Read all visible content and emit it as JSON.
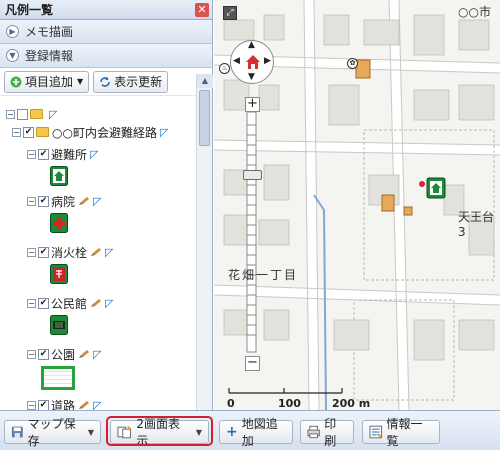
{
  "panel": {
    "title": "凡例一覧",
    "section_memo": "メモ描画",
    "section_registered": "登録情報",
    "add_item_label": "項目追加",
    "refresh_label": "表示更新"
  },
  "tree": {
    "group_label": "○○町内会避難経路",
    "items": [
      {
        "label": "避難所"
      },
      {
        "label": "病院"
      },
      {
        "label": "消火栓"
      },
      {
        "label": "公民館"
      },
      {
        "label": "公園"
      },
      {
        "label": "道路"
      }
    ]
  },
  "map": {
    "title": "○○市",
    "place1": "天王台3",
    "place2": "花畑一丁目",
    "scale_0": "0",
    "scale_100": "100",
    "scale_200": "200 m"
  },
  "toolbar": {
    "save_label": "マップ保存",
    "split_label": "2画面表示",
    "add_map_label": "地図追加",
    "print_label": "印刷",
    "info_list_label": "情報一覧"
  },
  "colors": {
    "highlight": "#d71f2a",
    "accent_blue": "#1e73c8"
  }
}
